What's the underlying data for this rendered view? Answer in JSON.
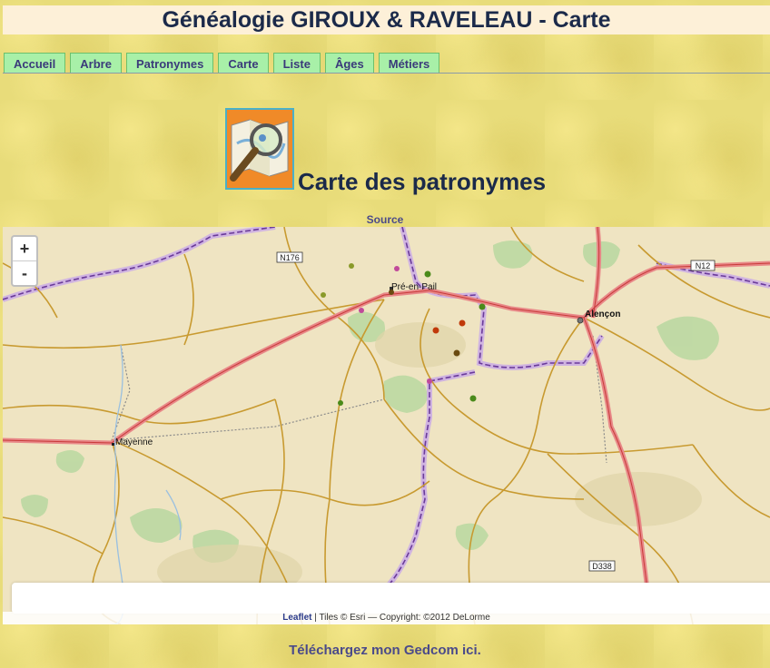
{
  "header": {
    "title": "Généalogie GIROUX & RAVELEAU - Carte"
  },
  "tabs": [
    "Accueil",
    "Arbre",
    "Patronymes",
    "Carte",
    "Liste",
    "Âges",
    "Métiers"
  ],
  "page": {
    "heading": "Carte des patronymes",
    "source_link": "Source",
    "download_link": "Téléchargez mon Gedcom ici."
  },
  "map": {
    "zoom_in": "+",
    "zoom_out": "-",
    "places": {
      "pre_en_pail": "Pré-en-Pail",
      "alencon": "Alençon",
      "mayenne": "Mayenne"
    },
    "roads": {
      "n176": "N176",
      "n12": "N12",
      "d338": "D338"
    },
    "attribution": {
      "leaflet": "Leaflet",
      "rest": " | Tiles © Esri — Copyright: ©2012 DeLorme"
    },
    "marker_colors": {
      "green": "#4a8a1a",
      "red": "#c0390a",
      "brown": "#6a4a10",
      "pink": "#c04a9a",
      "olive": "#8a9a2a"
    }
  },
  "colors": {
    "tab_bg": "#a8f0a8",
    "title_bg": "#fdf0d8",
    "link": "#4a4a8a"
  }
}
